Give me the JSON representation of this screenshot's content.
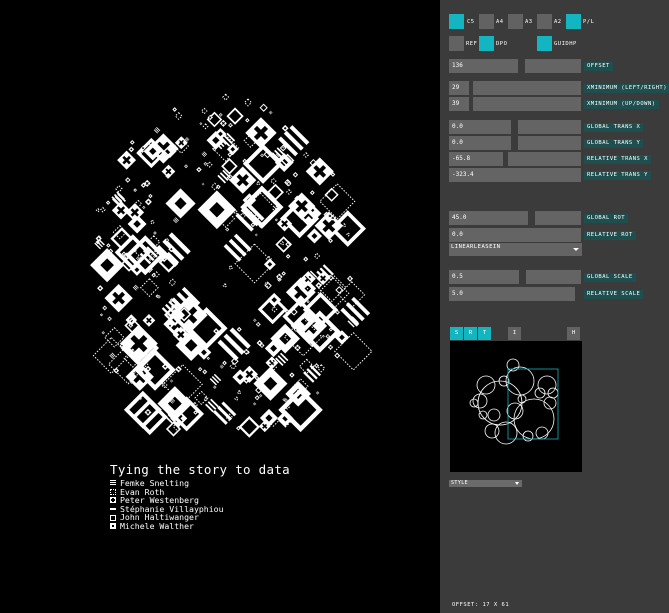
{
  "artwork": {
    "title": "Tying the story to data",
    "credits": [
      {
        "icon": "stripes-icon",
        "name": "Femke Snelting"
      },
      {
        "icon": "dotted-square-icon",
        "name": "Evan Roth"
      },
      {
        "icon": "plus-square-icon",
        "name": "Peter Westenberg"
      },
      {
        "icon": "dash-icon",
        "name": "Stéphanie Villayphiou"
      },
      {
        "icon": "square-outline-icon",
        "name": "John Haltiwanger"
      },
      {
        "icon": "filled-box-icon",
        "name": "Michele Walther"
      }
    ]
  },
  "panel": {
    "format_buttons": [
      {
        "label": "C5",
        "active": true
      },
      {
        "label": "A4",
        "active": false
      },
      {
        "label": "A3",
        "active": false
      },
      {
        "label": "A2",
        "active": false
      },
      {
        "label": "P/L",
        "active": true
      }
    ],
    "toggles": [
      {
        "label": "REF",
        "active": false
      },
      {
        "label": "DPO",
        "active": true
      },
      {
        "label": "GUIDHP",
        "active": true
      }
    ],
    "offset": {
      "value": "136",
      "label": "OFFSET"
    },
    "x_minimum": {
      "value": "29",
      "label": "XMINIMUM (LEFT/RIGHT)"
    },
    "y_minimum": {
      "value": "39",
      "label": "XMINIMUM (UP/DOWN)"
    },
    "global_trans_x": {
      "value": "0.0",
      "label": "GLOBAL TRANS X"
    },
    "global_trans_y": {
      "value": "0.0",
      "label": "GLOBAL TRANS Y"
    },
    "relative_trans_x": {
      "value": "-65.8",
      "label": "RELATIVE TRANS X"
    },
    "relative_trans_y": {
      "value": "-323.4",
      "label": "RELATIVE TRANS Y"
    },
    "global_rot": {
      "value": "45.0",
      "label": "GLOBAL ROT"
    },
    "relative_rot": {
      "value": "0.0",
      "label": "RELATIVE ROT"
    },
    "easing": {
      "value": "LINEARLEASEIN"
    },
    "global_scale": {
      "value": "0.5",
      "label": "GLOBAL SCALE"
    },
    "relative_scale": {
      "value": "5.0",
      "label": "RELATIVE SCALE"
    },
    "preview_tabs": [
      {
        "label": "S",
        "active": true
      },
      {
        "label": "R",
        "active": true
      },
      {
        "label": "T",
        "active": true
      },
      {
        "label": "I",
        "active": false
      },
      {
        "label": "H",
        "active": false
      }
    ],
    "style_dropdown": {
      "value": "STYLE"
    },
    "offset_readout": "OFFSET: 17 X 61"
  },
  "colors": {
    "accent": "#13b5c0",
    "panel_bg": "#3b3b3b",
    "control_bg": "#646464",
    "label_bg": "#1f4e4e",
    "canvas_bg": "#000000"
  }
}
